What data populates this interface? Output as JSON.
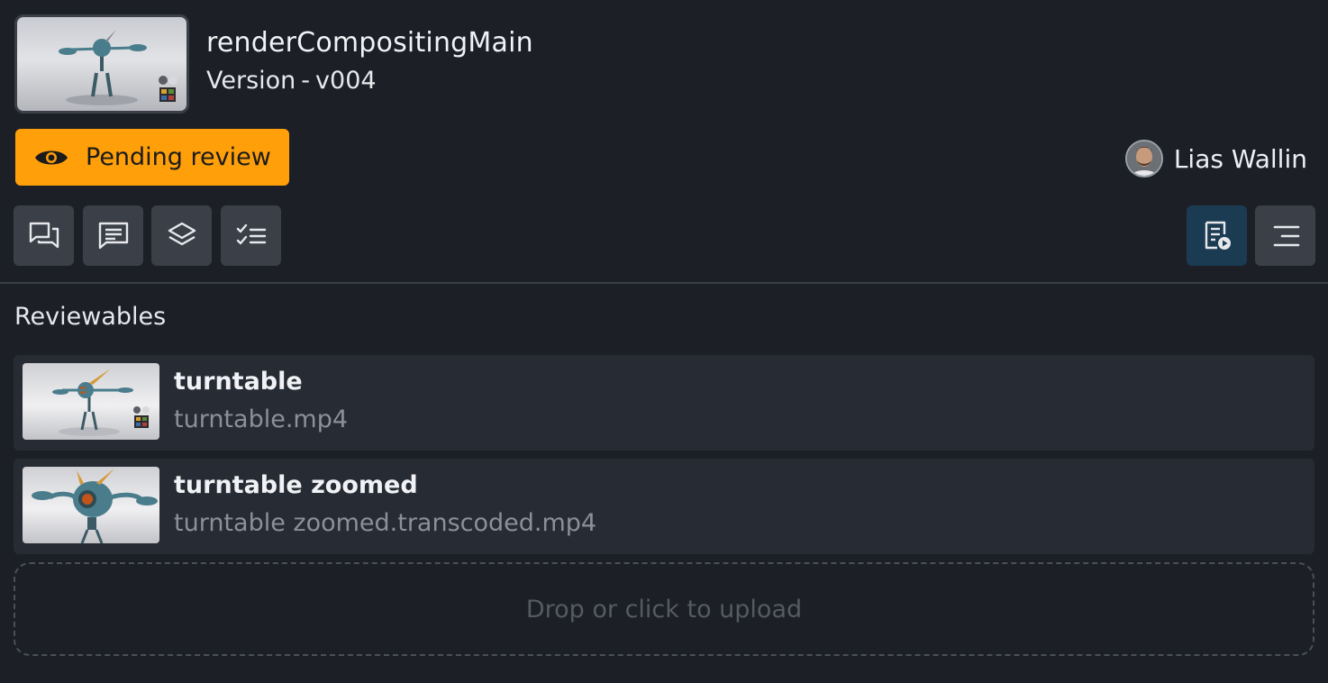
{
  "header": {
    "title": "renderCompositingMain",
    "version_prefix": "Version",
    "version_sep": "-",
    "version": "v004",
    "thumbnail_icon": "robot-thumbnail"
  },
  "status": {
    "label": "Pending review",
    "icon": "eye-icon",
    "color": "#ff9f0a"
  },
  "user": {
    "name": "Lias Wallin",
    "avatar": "avatar"
  },
  "toolbar": {
    "left": [
      {
        "icon": "comments-icon"
      },
      {
        "icon": "message-icon"
      },
      {
        "icon": "layers-icon"
      },
      {
        "icon": "checklist-icon"
      }
    ],
    "right": [
      {
        "icon": "review-playlist-icon",
        "active": true
      },
      {
        "icon": "menu-lines-icon",
        "active": false
      }
    ],
    "active_color": "#1b3b52"
  },
  "reviewables": {
    "title": "Reviewables",
    "items": [
      {
        "name": "turntable",
        "file": "turntable.mp4"
      },
      {
        "name": "turntable zoomed",
        "file": "turntable zoomed.transcoded.mp4"
      }
    ]
  },
  "dropzone": {
    "hint": "Drop or click to upload"
  }
}
